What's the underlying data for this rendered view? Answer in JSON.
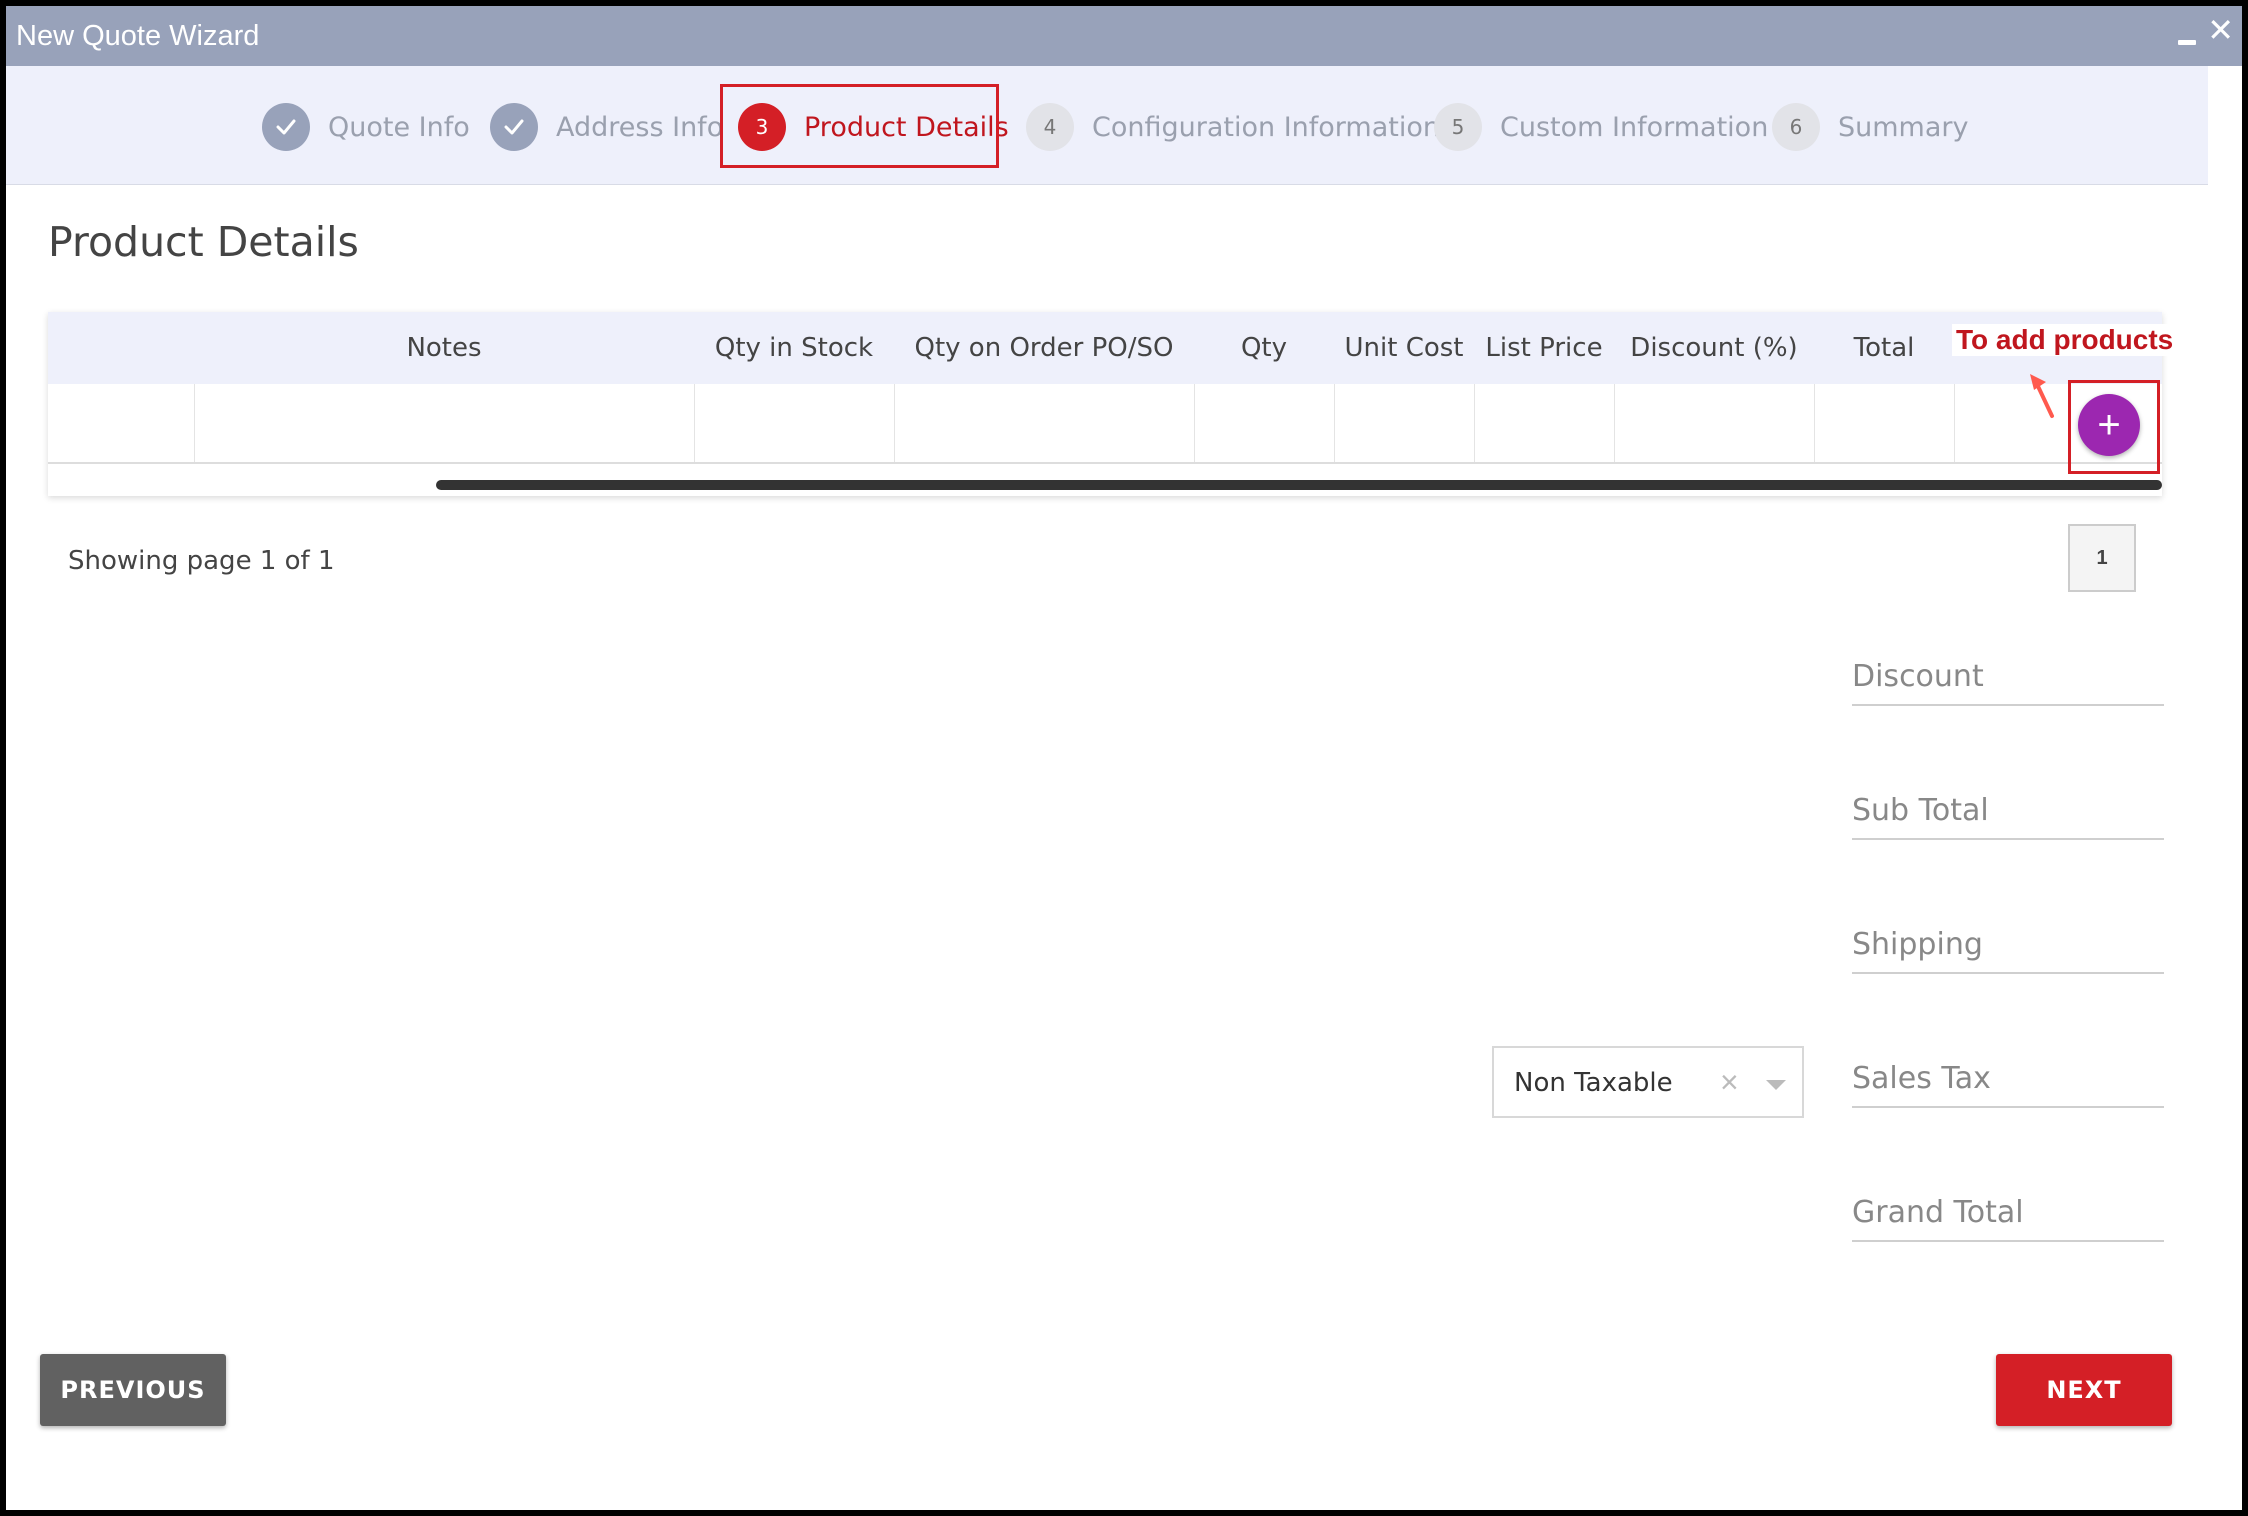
{
  "window": {
    "title": "New Quote Wizard"
  },
  "steps": [
    {
      "number": "",
      "label": "Quote Info",
      "state": "completed"
    },
    {
      "number": "",
      "label": "Address Info",
      "state": "completed"
    },
    {
      "number": "3",
      "label": "Product Details",
      "state": "active"
    },
    {
      "number": "4",
      "label": "Configuration Information",
      "state": "pending"
    },
    {
      "number": "5",
      "label": "Custom Information",
      "state": "pending"
    },
    {
      "number": "6",
      "label": "Summary",
      "state": "pending"
    }
  ],
  "page": {
    "title": "Product Details"
  },
  "grid": {
    "columns": [
      "",
      "Notes",
      "Qty in Stock",
      "Qty on Order PO/SO",
      "Qty",
      "Unit Cost",
      "List Price",
      "Discount (%)",
      "Total"
    ],
    "add_button_label": "+",
    "annotation": "To add products"
  },
  "paging": {
    "summary": "Showing page 1 of 1",
    "current_page": "1"
  },
  "totals": {
    "discount_label": "Discount",
    "subtotal_label": "Sub Total",
    "shipping_label": "Shipping",
    "sales_tax_label": "Sales Tax",
    "grand_total_label": "Grand Total"
  },
  "tax_select": {
    "value": "Non Taxable",
    "clear_glyph": "×"
  },
  "buttons": {
    "previous": "PREVIOUS",
    "next": "NEXT"
  },
  "colors": {
    "accent": "#d41f26",
    "add_button": "#9c27b0",
    "titlebar": "#98a2ba"
  }
}
